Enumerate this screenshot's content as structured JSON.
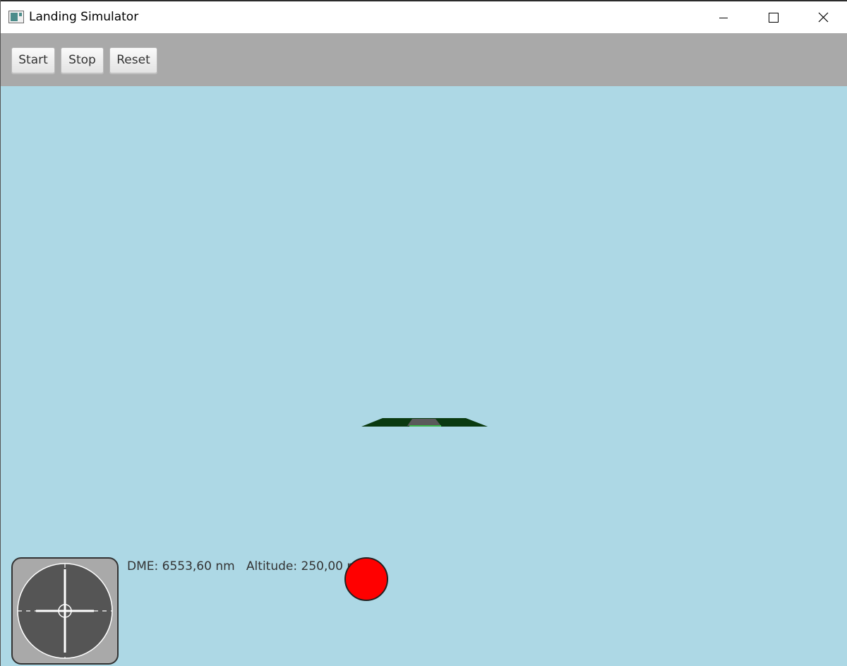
{
  "window": {
    "title": "Landing Simulator",
    "icon": "java-app-icon",
    "controls": [
      "minimize-icon",
      "maximize-icon",
      "close-icon"
    ]
  },
  "toolbar": {
    "start_label": "Start",
    "stop_label": "Stop",
    "reset_label": "Reset"
  },
  "scene": {
    "sky_color": "#add8e5",
    "ground_color": "#0b3a10",
    "runway_color": "#5a5a5a"
  },
  "instruments": {
    "dme_label": "DME:",
    "dme_value": "6553,60",
    "dme_unit": "nm",
    "altitude_label": "Altitude:",
    "altitude_value": "250,00",
    "altitude_unit": "m",
    "status_light_color": "#ff0000",
    "ils_gauge_icon": "ils-crosshair-icon"
  }
}
